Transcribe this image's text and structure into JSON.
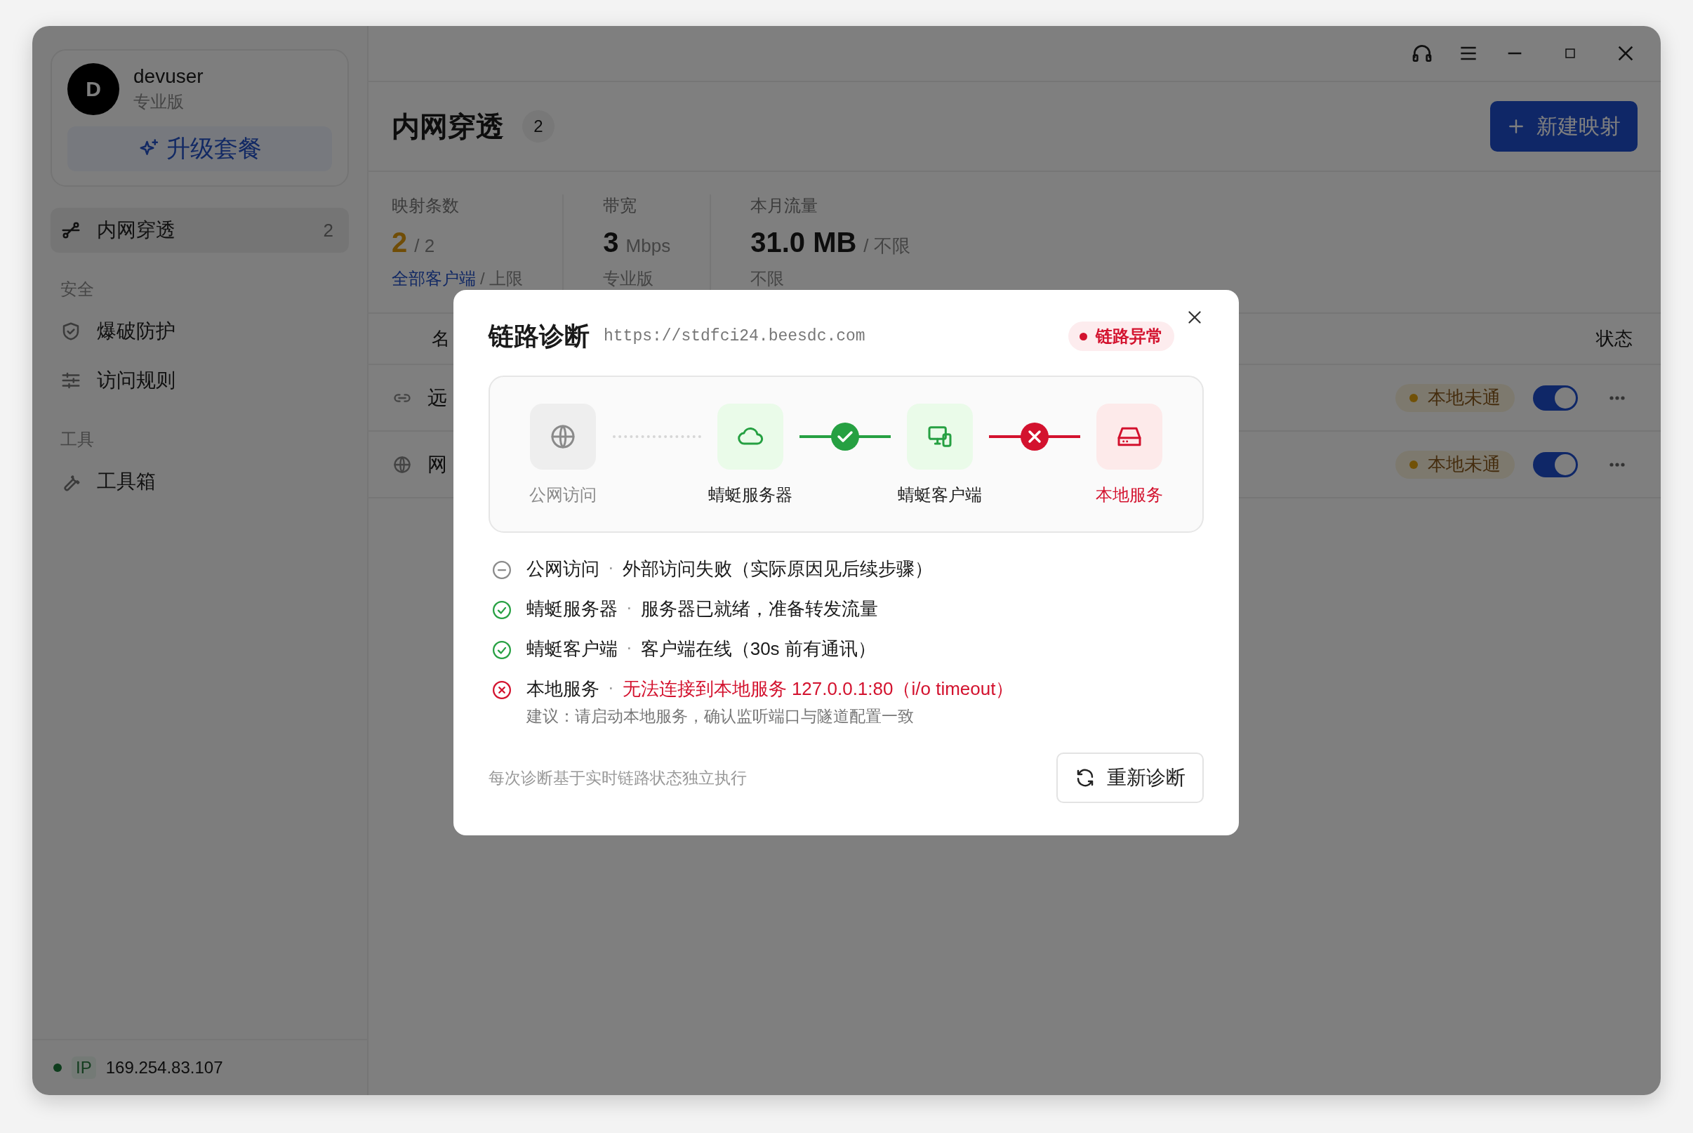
{
  "sidebar": {
    "user": {
      "initial": "D",
      "name": "devuser",
      "plan": "专业版"
    },
    "upgrade_button": "升级套餐",
    "sections": [
      {
        "items": [
          {
            "label": "内网穿透",
            "count": "2",
            "selected": true
          }
        ]
      },
      {
        "heading": "安全",
        "items": [
          {
            "label": "爆破防护",
            "selected": false
          },
          {
            "label": "访问规则",
            "selected": false
          }
        ]
      },
      {
        "heading": "工具",
        "items": [
          {
            "label": "工具箱",
            "selected": false
          }
        ]
      }
    ],
    "footer": {
      "online": true,
      "ip_label": "IP",
      "ip": "169.254.83.107"
    }
  },
  "header": {
    "title": "内网穿透",
    "count": "2",
    "new_button": "新建映射"
  },
  "stats": [
    {
      "label": "映射条数",
      "value": "2",
      "unit": "/ 2",
      "warning": true,
      "link": "全部客户端",
      "note": "/ 上限"
    },
    {
      "label": "带宽",
      "value": "3",
      "unit": "Mbps",
      "warning": false,
      "note": "专业版"
    },
    {
      "label": "本月流量",
      "value": "31.0 MB",
      "unit": "/ 不限",
      "warning": false,
      "note": "不限"
    }
  ],
  "table": {
    "columns": [
      "名",
      "状态"
    ],
    "rows": [
      {
        "name": "远",
        "status": "本地未通",
        "enabled": true
      },
      {
        "name": "网",
        "status": "本地未通",
        "enabled": true
      }
    ]
  },
  "dialog": {
    "title": "链路诊断",
    "url": "https://stdfci24.beesdc.com",
    "status": "链路异常",
    "nodes": [
      {
        "label": "公网访问",
        "kind": "idle"
      },
      {
        "label": "蜻蜓服务器",
        "kind": "ok"
      },
      {
        "label": "蜻蜓客户端",
        "kind": "ok"
      },
      {
        "label": "本地服务",
        "kind": "error"
      }
    ],
    "links": [
      {
        "kind": "idle"
      },
      {
        "kind": "ok"
      },
      {
        "kind": "error"
      }
    ],
    "separator": "·",
    "checks": [
      {
        "kind": "idle",
        "name": "公网访问",
        "message": "外部访问失败（实际原因见后续步骤）"
      },
      {
        "kind": "ok",
        "name": "蜻蜓服务器",
        "message": "服务器已就绪，准备转发流量"
      },
      {
        "kind": "ok",
        "name": "蜻蜓客户端",
        "message": "客户端在线（30s 前有通讯）"
      },
      {
        "kind": "error",
        "name": "本地服务",
        "message": "无法连接到本地服务 127.0.0.1:80（i/o timeout）",
        "hint": "建议：请启动本地服务，确认监听端口与隧道配置一致"
      }
    ],
    "note": "每次诊断基于实时链路状态独立执行",
    "rerun_button": "重新诊断"
  }
}
